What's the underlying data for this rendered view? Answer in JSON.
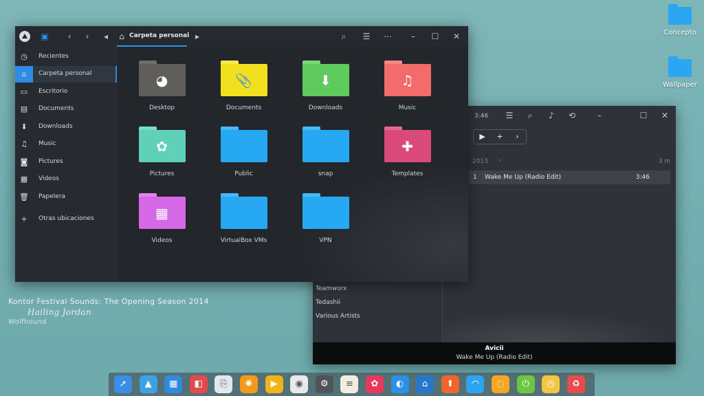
{
  "desktop": {
    "icons": [
      {
        "label": "Concepto"
      },
      {
        "label": "Wallpaper"
      }
    ]
  },
  "album_art_text": {
    "title": "Kontor Festival Sounds: The Opening Season 2014",
    "signature": "Hailing Jordan",
    "label": "Wolfhound"
  },
  "file_manager": {
    "breadcrumb": "Carpeta personal",
    "sidebar": [
      {
        "label": "Recientes",
        "icon": "clock-icon"
      },
      {
        "label": "Carpeta personal",
        "icon": "home-icon",
        "active": true
      },
      {
        "label": "Escritorio",
        "icon": "desktop-icon"
      },
      {
        "label": "Documents",
        "icon": "document-icon"
      },
      {
        "label": "Downloads",
        "icon": "download-icon"
      },
      {
        "label": "Music",
        "icon": "music-note-icon"
      },
      {
        "label": "Pictures",
        "icon": "camera-icon"
      },
      {
        "label": "Videos",
        "icon": "film-icon"
      },
      {
        "label": "Papelera",
        "icon": "trash-icon"
      },
      {
        "label": "Otras ubicaciones",
        "icon": "plus-icon"
      }
    ],
    "folders": [
      {
        "label": "Desktop",
        "color": "#5f5e5b",
        "tab": "#6e6d6a",
        "glyph": "◕"
      },
      {
        "label": "Documents",
        "color": "#f2df1d",
        "tab": "#f7e84d",
        "glyph": "📎"
      },
      {
        "label": "Downloads",
        "color": "#5fcb5f",
        "tab": "#78d878",
        "glyph": "⬇"
      },
      {
        "label": "Music",
        "color": "#f36b6b",
        "tab": "#f88686",
        "glyph": "♫"
      },
      {
        "label": "Pictures",
        "color": "#5fd1b9",
        "tab": "#7bdcc8",
        "glyph": "✿"
      },
      {
        "label": "Public",
        "color": "#27a8f3",
        "tab": "#46b8f6",
        "glyph": ""
      },
      {
        "label": "snap",
        "color": "#27a8f3",
        "tab": "#46b8f6",
        "glyph": ""
      },
      {
        "label": "Templates",
        "color": "#d9497a",
        "tab": "#e3688f",
        "glyph": "✚"
      },
      {
        "label": "Videos",
        "color": "#d468e6",
        "tab": "#de86ec",
        "glyph": "▦"
      },
      {
        "label": "VirtualBox VMs",
        "color": "#27a8f3",
        "tab": "#46b8f6",
        "glyph": ""
      },
      {
        "label": "VPN",
        "color": "#27a8f3",
        "tab": "#46b8f6",
        "glyph": ""
      }
    ]
  },
  "player": {
    "time": "3:46",
    "year": "2013",
    "length": "3 m",
    "track": {
      "number": "1",
      "title": "Wake Me Up (Radio Edit)",
      "duration": "3:46"
    },
    "artists": [
      "Teamworx",
      "Tedashii",
      "Various Artists"
    ],
    "now_playing": {
      "artist": "Avicii",
      "title": "Wake Me Up (Radio Edit)"
    }
  },
  "dock": {
    "items": [
      {
        "icon": "rocket-launcher-icon",
        "color": "#3a8ee6"
      },
      {
        "icon": "image-viewer-icon",
        "color": "#3fa2e0"
      },
      {
        "icon": "multitask-view-icon",
        "color": "#2f8ae0"
      },
      {
        "icon": "file-manager-icon",
        "color": "#e24b4b"
      },
      {
        "icon": "screenshot-icon",
        "color": "#e4e8ec"
      },
      {
        "icon": "orange-app-icon",
        "color": "#f39a1a"
      },
      {
        "icon": "media-player-icon",
        "color": "#f2b21a"
      },
      {
        "icon": "chrome-icon",
        "color": "#e9e9e9"
      },
      {
        "icon": "settings-icon",
        "color": "#505459"
      },
      {
        "icon": "text-editor-icon",
        "color": "#f1ede1"
      },
      {
        "icon": "music-app-icon",
        "color": "#e8385c"
      },
      {
        "icon": "finder-icon",
        "color": "#2e8fe6"
      },
      {
        "icon": "store-icon",
        "color": "#2578cc"
      },
      {
        "icon": "upload-icon",
        "color": "#f0652c"
      },
      {
        "icon": "wifi-icon",
        "color": "#2ea4f0"
      },
      {
        "icon": "orange-circle-icon",
        "color": "#f5a623"
      },
      {
        "icon": "power-icon",
        "color": "#6cc644"
      },
      {
        "icon": "clock-widget-icon",
        "color": "#f4c542"
      },
      {
        "icon": "trash-icon",
        "color": "#e94a4a"
      }
    ]
  }
}
